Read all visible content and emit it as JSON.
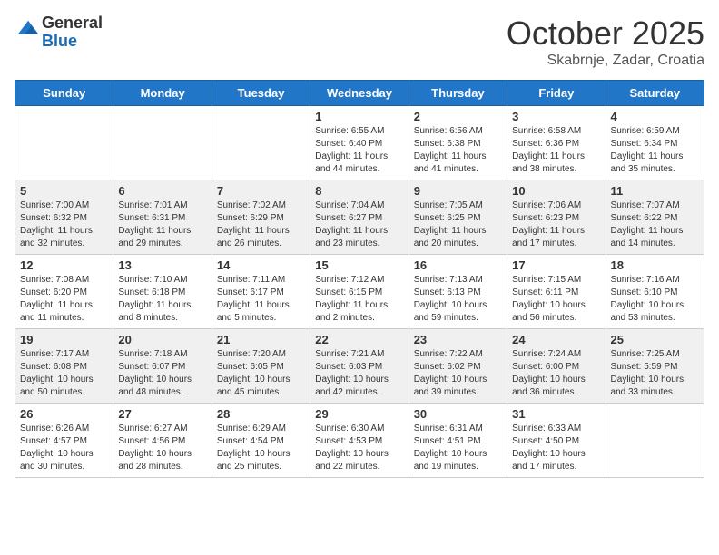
{
  "logo": {
    "general": "General",
    "blue": "Blue"
  },
  "header": {
    "month": "October 2025",
    "location": "Skabrnje, Zadar, Croatia"
  },
  "weekdays": [
    "Sunday",
    "Monday",
    "Tuesday",
    "Wednesday",
    "Thursday",
    "Friday",
    "Saturday"
  ],
  "weeks": [
    [
      {
        "day": "",
        "info": ""
      },
      {
        "day": "",
        "info": ""
      },
      {
        "day": "",
        "info": ""
      },
      {
        "day": "1",
        "info": "Sunrise: 6:55 AM\nSunset: 6:40 PM\nDaylight: 11 hours and 44 minutes."
      },
      {
        "day": "2",
        "info": "Sunrise: 6:56 AM\nSunset: 6:38 PM\nDaylight: 11 hours and 41 minutes."
      },
      {
        "day": "3",
        "info": "Sunrise: 6:58 AM\nSunset: 6:36 PM\nDaylight: 11 hours and 38 minutes."
      },
      {
        "day": "4",
        "info": "Sunrise: 6:59 AM\nSunset: 6:34 PM\nDaylight: 11 hours and 35 minutes."
      }
    ],
    [
      {
        "day": "5",
        "info": "Sunrise: 7:00 AM\nSunset: 6:32 PM\nDaylight: 11 hours and 32 minutes."
      },
      {
        "day": "6",
        "info": "Sunrise: 7:01 AM\nSunset: 6:31 PM\nDaylight: 11 hours and 29 minutes."
      },
      {
        "day": "7",
        "info": "Sunrise: 7:02 AM\nSunset: 6:29 PM\nDaylight: 11 hours and 26 minutes."
      },
      {
        "day": "8",
        "info": "Sunrise: 7:04 AM\nSunset: 6:27 PM\nDaylight: 11 hours and 23 minutes."
      },
      {
        "day": "9",
        "info": "Sunrise: 7:05 AM\nSunset: 6:25 PM\nDaylight: 11 hours and 20 minutes."
      },
      {
        "day": "10",
        "info": "Sunrise: 7:06 AM\nSunset: 6:23 PM\nDaylight: 11 hours and 17 minutes."
      },
      {
        "day": "11",
        "info": "Sunrise: 7:07 AM\nSunset: 6:22 PM\nDaylight: 11 hours and 14 minutes."
      }
    ],
    [
      {
        "day": "12",
        "info": "Sunrise: 7:08 AM\nSunset: 6:20 PM\nDaylight: 11 hours and 11 minutes."
      },
      {
        "day": "13",
        "info": "Sunrise: 7:10 AM\nSunset: 6:18 PM\nDaylight: 11 hours and 8 minutes."
      },
      {
        "day": "14",
        "info": "Sunrise: 7:11 AM\nSunset: 6:17 PM\nDaylight: 11 hours and 5 minutes."
      },
      {
        "day": "15",
        "info": "Sunrise: 7:12 AM\nSunset: 6:15 PM\nDaylight: 11 hours and 2 minutes."
      },
      {
        "day": "16",
        "info": "Sunrise: 7:13 AM\nSunset: 6:13 PM\nDaylight: 10 hours and 59 minutes."
      },
      {
        "day": "17",
        "info": "Sunrise: 7:15 AM\nSunset: 6:11 PM\nDaylight: 10 hours and 56 minutes."
      },
      {
        "day": "18",
        "info": "Sunrise: 7:16 AM\nSunset: 6:10 PM\nDaylight: 10 hours and 53 minutes."
      }
    ],
    [
      {
        "day": "19",
        "info": "Sunrise: 7:17 AM\nSunset: 6:08 PM\nDaylight: 10 hours and 50 minutes."
      },
      {
        "day": "20",
        "info": "Sunrise: 7:18 AM\nSunset: 6:07 PM\nDaylight: 10 hours and 48 minutes."
      },
      {
        "day": "21",
        "info": "Sunrise: 7:20 AM\nSunset: 6:05 PM\nDaylight: 10 hours and 45 minutes."
      },
      {
        "day": "22",
        "info": "Sunrise: 7:21 AM\nSunset: 6:03 PM\nDaylight: 10 hours and 42 minutes."
      },
      {
        "day": "23",
        "info": "Sunrise: 7:22 AM\nSunset: 6:02 PM\nDaylight: 10 hours and 39 minutes."
      },
      {
        "day": "24",
        "info": "Sunrise: 7:24 AM\nSunset: 6:00 PM\nDaylight: 10 hours and 36 minutes."
      },
      {
        "day": "25",
        "info": "Sunrise: 7:25 AM\nSunset: 5:59 PM\nDaylight: 10 hours and 33 minutes."
      }
    ],
    [
      {
        "day": "26",
        "info": "Sunrise: 6:26 AM\nSunset: 4:57 PM\nDaylight: 10 hours and 30 minutes."
      },
      {
        "day": "27",
        "info": "Sunrise: 6:27 AM\nSunset: 4:56 PM\nDaylight: 10 hours and 28 minutes."
      },
      {
        "day": "28",
        "info": "Sunrise: 6:29 AM\nSunset: 4:54 PM\nDaylight: 10 hours and 25 minutes."
      },
      {
        "day": "29",
        "info": "Sunrise: 6:30 AM\nSunset: 4:53 PM\nDaylight: 10 hours and 22 minutes."
      },
      {
        "day": "30",
        "info": "Sunrise: 6:31 AM\nSunset: 4:51 PM\nDaylight: 10 hours and 19 minutes."
      },
      {
        "day": "31",
        "info": "Sunrise: 6:33 AM\nSunset: 4:50 PM\nDaylight: 10 hours and 17 minutes."
      },
      {
        "day": "",
        "info": ""
      }
    ]
  ]
}
